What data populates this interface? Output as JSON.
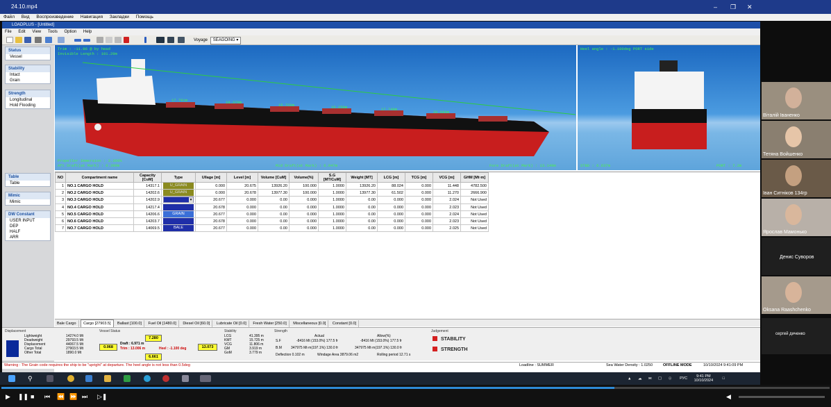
{
  "player": {
    "file": "24.10.mp4",
    "menu": [
      "Файл",
      "Вид",
      "Воспроизведение",
      "Навигация",
      "Закладки",
      "Помощь"
    ]
  },
  "app": {
    "title": "LOADPLUS - [Untitled]",
    "menu": [
      "File",
      "Edit",
      "View",
      "Tools",
      "Option",
      "Help"
    ],
    "voyage_label": "Voyage",
    "voyage_value": "SEAGOING"
  },
  "sidebar": {
    "groups": [
      {
        "title": "Status",
        "items": [
          "Vessel"
        ]
      },
      {
        "title": "Stability",
        "items": [
          "Intact",
          "Grain"
        ]
      },
      {
        "title": "Strength",
        "items": [
          "Longitudinal",
          "Hold Flooding"
        ]
      },
      {
        "title": "Table",
        "items": [
          "Table"
        ]
      },
      {
        "title": "Mimic",
        "items": [
          "Mimic"
        ]
      },
      {
        "title": "DW Constant",
        "items": [
          "USER INPUT",
          "DEP",
          "HALF",
          "ARR"
        ]
      }
    ]
  },
  "view": {
    "trim": "Trim  :  -11.96 @ by head",
    "inv_len": "Invisible Length  :  101.20m",
    "holds": [
      "17.781m",
      "19.370m",
      "15.720m",
      "15.258m",
      "17.749m",
      "20.688m"
    ],
    "prop": "Propeller Immersion  :  3.369%",
    "aft": "Aft Draft(at Mark)  :  0.399m",
    "mid": "Mid Draft(at Mark)  :  6.947m",
    "fore": "Fore Draft(at Mark)  :  13.149m",
    "heel": "Heel angle  :  -1.100deg PORT side",
    "stbd": "STBD  :  6.637m",
    "port": "PORT  :  7.2m"
  },
  "table": {
    "headers": [
      "NO",
      "Compartment name",
      "Capacity [CuM]",
      "Type",
      "Ullage [m]",
      "Level [m]",
      "Volume [CuM]",
      "Volume(%)",
      "S.G [MT/CuM]",
      "Weight [MT]",
      "LCG [m]",
      "TCG [m]",
      "VCG [m]",
      "GHM [Mt·m]"
    ],
    "rows": [
      {
        "no": "1",
        "name": "NO.1 CARGO HOLD",
        "cap": "14317.1",
        "type": "U_GRAIN",
        "ull": "0.000",
        "lev": "20.675",
        "vol": "13926.20",
        "pct": "100.000",
        "sg": "1.0000",
        "wt": "13926.20",
        "lcg": "88.024",
        "tcg": "0.000",
        "vcg": "11.448",
        "ghm": "4782.500"
      },
      {
        "no": "2",
        "name": "NO.2 CARGO HOLD",
        "cap": "14202.6",
        "type": "U_GRAIN",
        "ull": "0.000",
        "lev": "20.678",
        "vol": "13977.30",
        "pct": "100.000",
        "sg": "1.0000",
        "wt": "13977.30",
        "lcg": "61.502",
        "tcg": "0.000",
        "vcg": "11.270",
        "ghm": "2666.900"
      },
      {
        "no": "3",
        "name": "NO.3 CARGO HOLD",
        "cap": "14202.9",
        "type": "",
        "ull": "20.677",
        "lev": "0.000",
        "vol": "0.00",
        "pct": "0.000",
        "sg": "1.0000",
        "wt": "0.00",
        "lcg": "0.000",
        "tcg": "0.000",
        "vcg": "2.024",
        "ghm": "Not Used"
      },
      {
        "no": "4",
        "name": "NO.4 CARGO HOLD",
        "cap": "14217.4",
        "type": "",
        "ull": "20.678",
        "lev": "0.000",
        "vol": "0.00",
        "pct": "0.000",
        "sg": "1.0000",
        "wt": "0.00",
        "lcg": "0.000",
        "tcg": "0.000",
        "vcg": "2.023",
        "ghm": "Not Used"
      },
      {
        "no": "5",
        "name": "NO.5 CARGO HOLD",
        "cap": "14206.6",
        "type": "GRAIN",
        "ull": "20.677",
        "lev": "0.000",
        "vol": "0.00",
        "pct": "0.000",
        "sg": "1.0000",
        "wt": "0.00",
        "lcg": "0.000",
        "tcg": "0.000",
        "vcg": "2.024",
        "ghm": "Not Used"
      },
      {
        "no": "6",
        "name": "NO.6 CARGO HOLD",
        "cap": "14203.7",
        "type": "",
        "ull": "20.678",
        "lev": "0.000",
        "vol": "0.00",
        "pct": "0.000",
        "sg": "1.0000",
        "wt": "0.00",
        "lcg": "0.000",
        "tcg": "0.000",
        "vcg": "2.023",
        "ghm": "Not Used"
      },
      {
        "no": "7",
        "name": "NO.7 CARGO HOLD",
        "cap": "14069.5",
        "type": "BALE",
        "ull": "20.677",
        "lev": "0.000",
        "vol": "0.00",
        "pct": "0.000",
        "sg": "1.0000",
        "wt": "0.00",
        "lcg": "0.000",
        "tcg": "0.000",
        "vcg": "2.025",
        "ghm": "Not Used"
      }
    ]
  },
  "tabs": [
    "Bale Cargo",
    "Cargo [27903.5]",
    "Ballast [100.0]",
    "Fuel Oil [1480.0]",
    "Diesel Oil [60.0]",
    "Lubricate Oil [0.0]",
    "Fresh Water [250.0]",
    "Miscellaneous [0.0]",
    "Constant [0.0]"
  ],
  "displacement": {
    "title": "Displacement",
    "rows": [
      [
        "Lightweight",
        "14274.0 Mt"
      ],
      [
        "Deadweight",
        "29793.5 Mt"
      ],
      [
        "Displacement",
        "44067.5 Mt"
      ],
      [
        "Cargo Total",
        "27903.5 Mt"
      ],
      [
        "Other Total",
        "1890.0 Mt"
      ]
    ]
  },
  "vessel_status": {
    "title": "Vessel Status",
    "draft_top": "7.280",
    "aft": "0.068",
    "fore": "13.073",
    "draft": "Draft  :  6.971 m",
    "trim": "Trim  :  13.006 m",
    "heel": "Heel  :  -1.100 deg",
    "draft_bottom": "6.661"
  },
  "stability": {
    "title": "Stability",
    "rows": [
      [
        "LCG",
        "41.395 m"
      ],
      [
        "KMT",
        "15.725 m"
      ],
      [
        "VCG",
        "11.806 m"
      ],
      [
        "GM",
        "3.919 m"
      ],
      [
        "GoM",
        "3.779 m"
      ]
    ]
  },
  "strength": {
    "title": "Strength",
    "actual_hdr": "Actual",
    "allow_hdr": "Allow(%)",
    "sf": "S.F",
    "sf_act": "-8416  Mt  (153.0%)  177.5 fr",
    "sf_allow": "-8416  Mt  (153.0%)  177.5 fr",
    "bm": "B.M",
    "bm_act": "347975  Mt·m(197.1%)  130.0 fr",
    "bm_allow": "347975  Mt·m(197.1%)  130.0 fr",
    "defl": "Deflection  0.102 m",
    "wind": "Windage Area  3879.06 m2",
    "roll": "Rolling period  12.71 s"
  },
  "judgement": {
    "title": "Judgement",
    "stability": "STABILITY",
    "strength": "STRENGTH"
  },
  "status_bar": {
    "warning": "Warning : The Grain code requires the ship to be \"upright\" at departure. The heel angle is not less than 0.5deg",
    "loadline": "Loadline : SUMMER",
    "density": "Sea Water Density : 1.0250",
    "mode": "OFFLINE MODE",
    "datetime": "10/10/2024 9:41:09 PM"
  },
  "taskbar": {
    "lang": "РУС",
    "time": "9:41 PM",
    "date": "10/10/2024"
  },
  "participants": [
    "Віталій Іваненко",
    "Тетяна Войшенко",
    "Іван Ситніков 134гр",
    "Ярослав Мамонько",
    "Денис Суворов",
    "Oksana Raashchenko",
    "сергей диченко"
  ],
  "colors": {
    "accent": "#1e4fa8",
    "grain_cell": "#8b8b20",
    "blue_cell": "#1f2ea8",
    "warning": "#c00000"
  }
}
